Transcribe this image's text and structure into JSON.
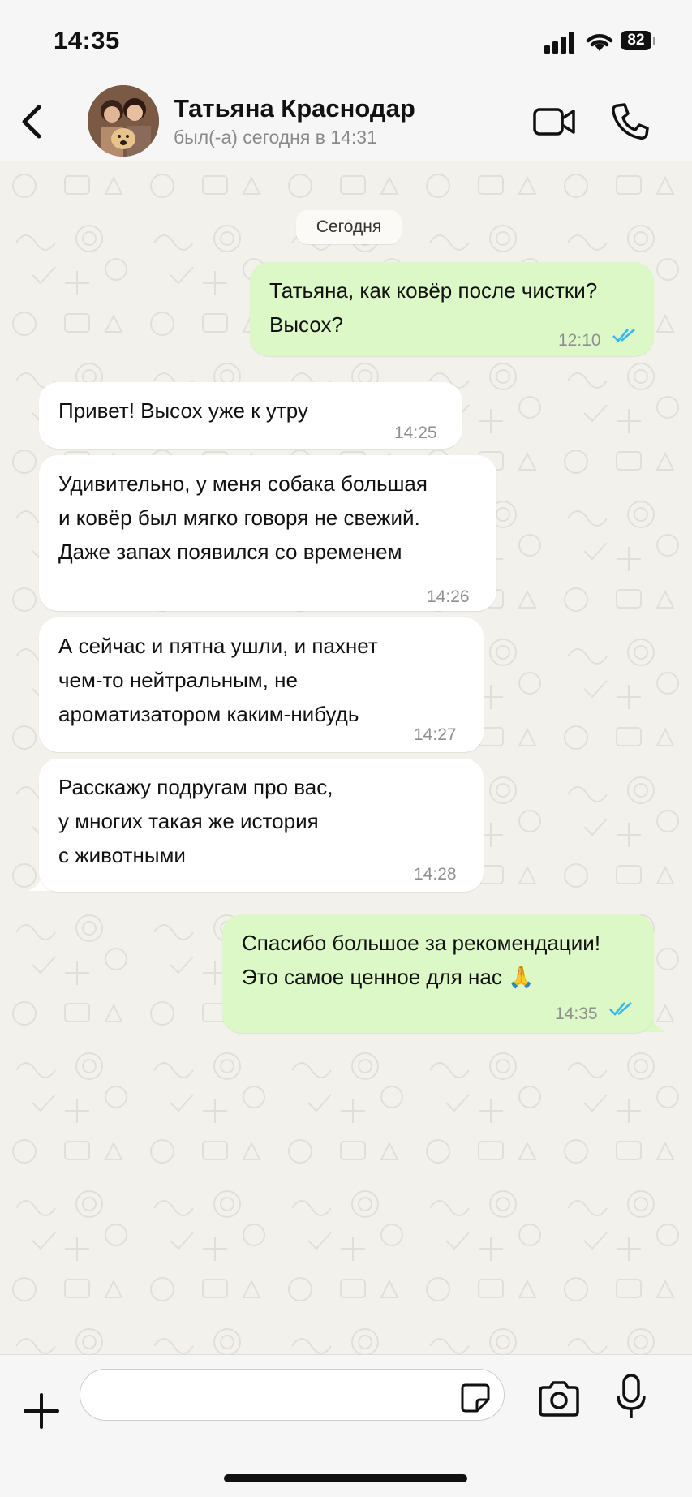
{
  "status_bar": {
    "time": "14:35",
    "battery": "82"
  },
  "header": {
    "contact_name": "Татьяна Краснодар",
    "contact_status": "был(-а) сегодня в 14:31",
    "back_icon": "chevron-left-icon",
    "video_icon": "video-camera-icon",
    "call_icon": "phone-icon"
  },
  "chat": {
    "date_label": "Сегодня",
    "messages": [
      {
        "direction": "out",
        "text": "Татьяна, как ковёр после чистки?\nВысох?",
        "time": "12:10",
        "status": "read"
      },
      {
        "direction": "in",
        "text": "Привет! Высох уже к утру",
        "time": "14:25"
      },
      {
        "direction": "in",
        "text": "Удивительно, у меня собака большая\nи ковёр был мягко говоря не свежий.\nДаже запах появился со временем",
        "time": "14:26"
      },
      {
        "direction": "in",
        "text": "А сейчас и пятна ушли, и пахнет\nчем-то нейтральным, не\nароматизатором каким-нибудь",
        "time": "14:27"
      },
      {
        "direction": "in",
        "text": "Расскажу подругам про вас,\nу многих такая же история\nс животными",
        "time": "14:28"
      },
      {
        "direction": "out",
        "text": "Спасибо большое за рекомендации!\nЭто самое ценное для нас 🙏",
        "time": "14:35",
        "status": "read"
      }
    ]
  },
  "input_bar": {
    "message_value": "",
    "placeholder": ""
  },
  "colors": {
    "outgoing_bubble": "#dcf8c6",
    "incoming_bubble": "#ffffff",
    "read_ticks": "#34b7f1",
    "wallpaper": "#f3f1ec"
  }
}
